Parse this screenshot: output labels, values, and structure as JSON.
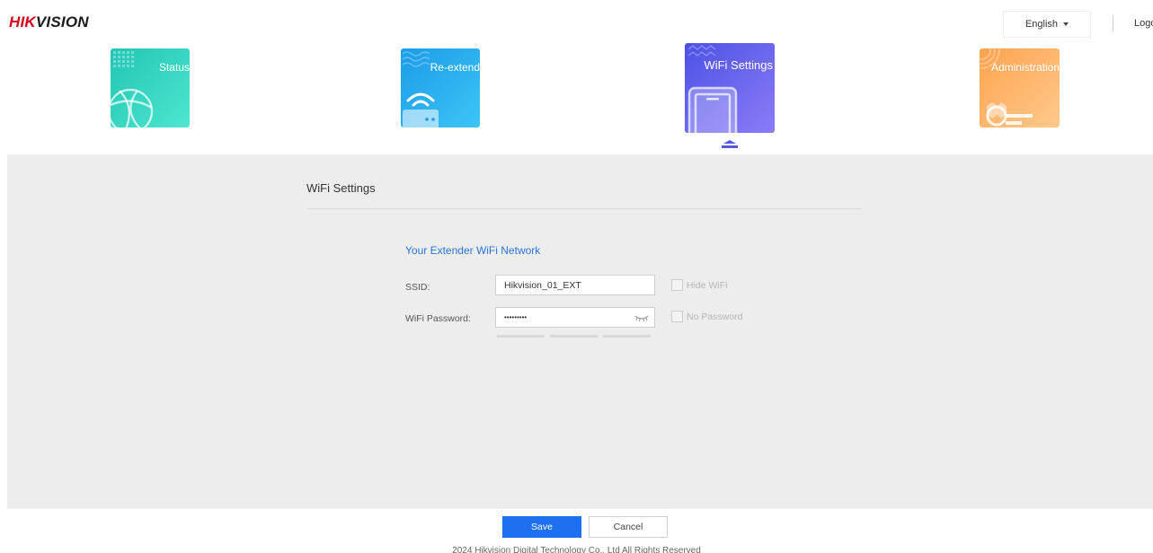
{
  "header": {
    "logo_brand_red": "HIK",
    "logo_brand_dark": "VISION",
    "language": "English",
    "logout": "Logout"
  },
  "tiles": [
    {
      "label": "Status",
      "color": "#2fd6c0",
      "icon": "globe-icon"
    },
    {
      "label": "Re-extend",
      "color": "#2aaef0",
      "icon": "router-wifi-icon"
    },
    {
      "label": "WiFi Settings",
      "color": "#5c5ff0",
      "icon": "phone-icon",
      "active": true
    },
    {
      "label": "Administration",
      "color": "#ffb46a",
      "icon": "gear-key-icon"
    }
  ],
  "main": {
    "section_title": "WiFi Settings",
    "subheading": "Your Extender WiFi Network",
    "ssid_label": "SSID:",
    "ssid_value": "Hikvision_01_EXT",
    "hide_wifi_label": "Hide WiFi",
    "password_label": "WiFi Password:",
    "password_value": "•••••••••",
    "no_password_label": "No Password"
  },
  "footer": {
    "save_label": "Save",
    "cancel_label": "Cancel",
    "copyright": "2024 Hikvision Digital Technology Co., Ltd All Rights Reserved"
  },
  "colors": {
    "accent": "#1f6ff2",
    "link": "#2b73d6",
    "brand_red": "#d6001c"
  }
}
